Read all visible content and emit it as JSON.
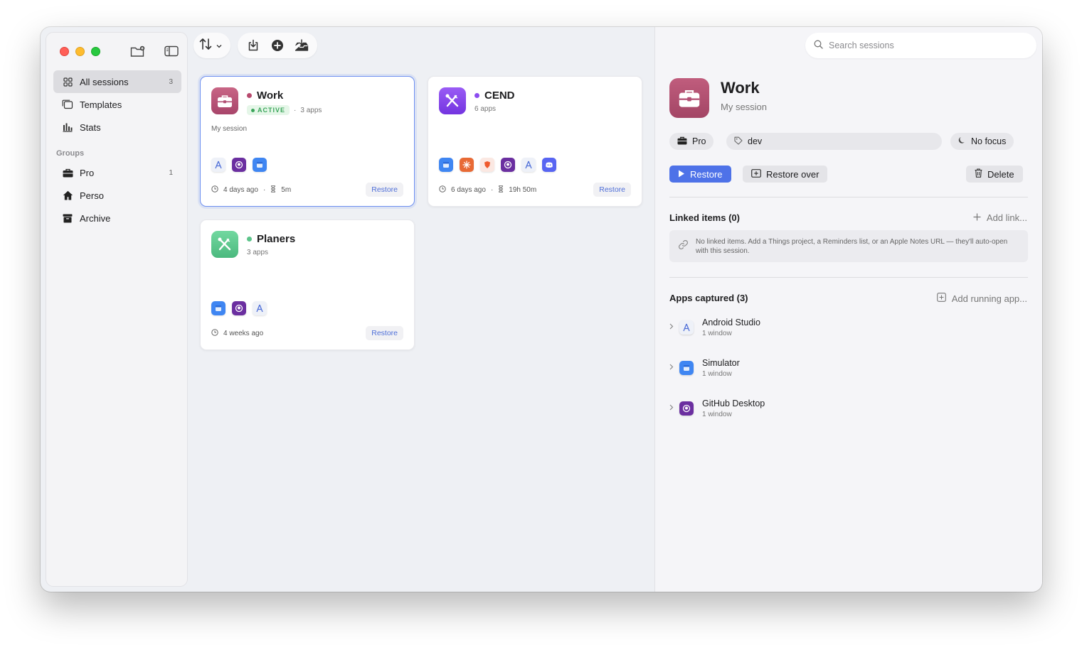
{
  "sidebar": {
    "items": [
      {
        "label": "All sessions",
        "count": "3"
      },
      {
        "label": "Templates"
      },
      {
        "label": "Stats"
      }
    ],
    "groups_label": "Groups",
    "groups": [
      {
        "label": "Pro",
        "count": "1"
      },
      {
        "label": "Perso"
      },
      {
        "label": "Archive"
      }
    ]
  },
  "sessions": [
    {
      "name": "Work",
      "status": "ACTIVE",
      "apps": "3 apps",
      "description": "My session",
      "time_ago": "4 days ago",
      "duration": "5m",
      "restore_label": "Restore",
      "dot_color": "#b84a6e"
    },
    {
      "name": "CEND",
      "apps": "6 apps",
      "time_ago": "6 days ago",
      "duration": "19h 50m",
      "restore_label": "Restore",
      "dot_color": "#8b4cf0"
    },
    {
      "name": "Planers",
      "apps": "3 apps",
      "time_ago": "4 weeks ago",
      "restore_label": "Restore",
      "dot_color": "#5cc48a"
    }
  ],
  "separator": "·",
  "search": {
    "placeholder": "Search sessions"
  },
  "detail": {
    "title": "Work",
    "subtitle": "My session",
    "group_chip": "Pro",
    "tag_chip": "dev",
    "focus_chip": "No focus",
    "restore_label": "Restore",
    "restore_over_label": "Restore over",
    "delete_label": "Delete",
    "linked_title": "Linked items (0)",
    "add_link_label": "Add link...",
    "empty_linked": "No linked items. Add a Things project, a Reminders list, or an Apple Notes URL — they'll auto-open with this session.",
    "apps_title": "Apps captured (3)",
    "add_running_label": "Add running app...",
    "apps": [
      {
        "name": "Android Studio",
        "windows": "1 window"
      },
      {
        "name": "Simulator",
        "windows": "1 window"
      },
      {
        "name": "GitHub Desktop",
        "windows": "1 window"
      }
    ]
  },
  "colors": {
    "accent": "#4e72e8",
    "work": "#b84a6e",
    "cend": "#8b4cf0",
    "planers": "#5cc48a",
    "active_green": "#3aa55a"
  }
}
